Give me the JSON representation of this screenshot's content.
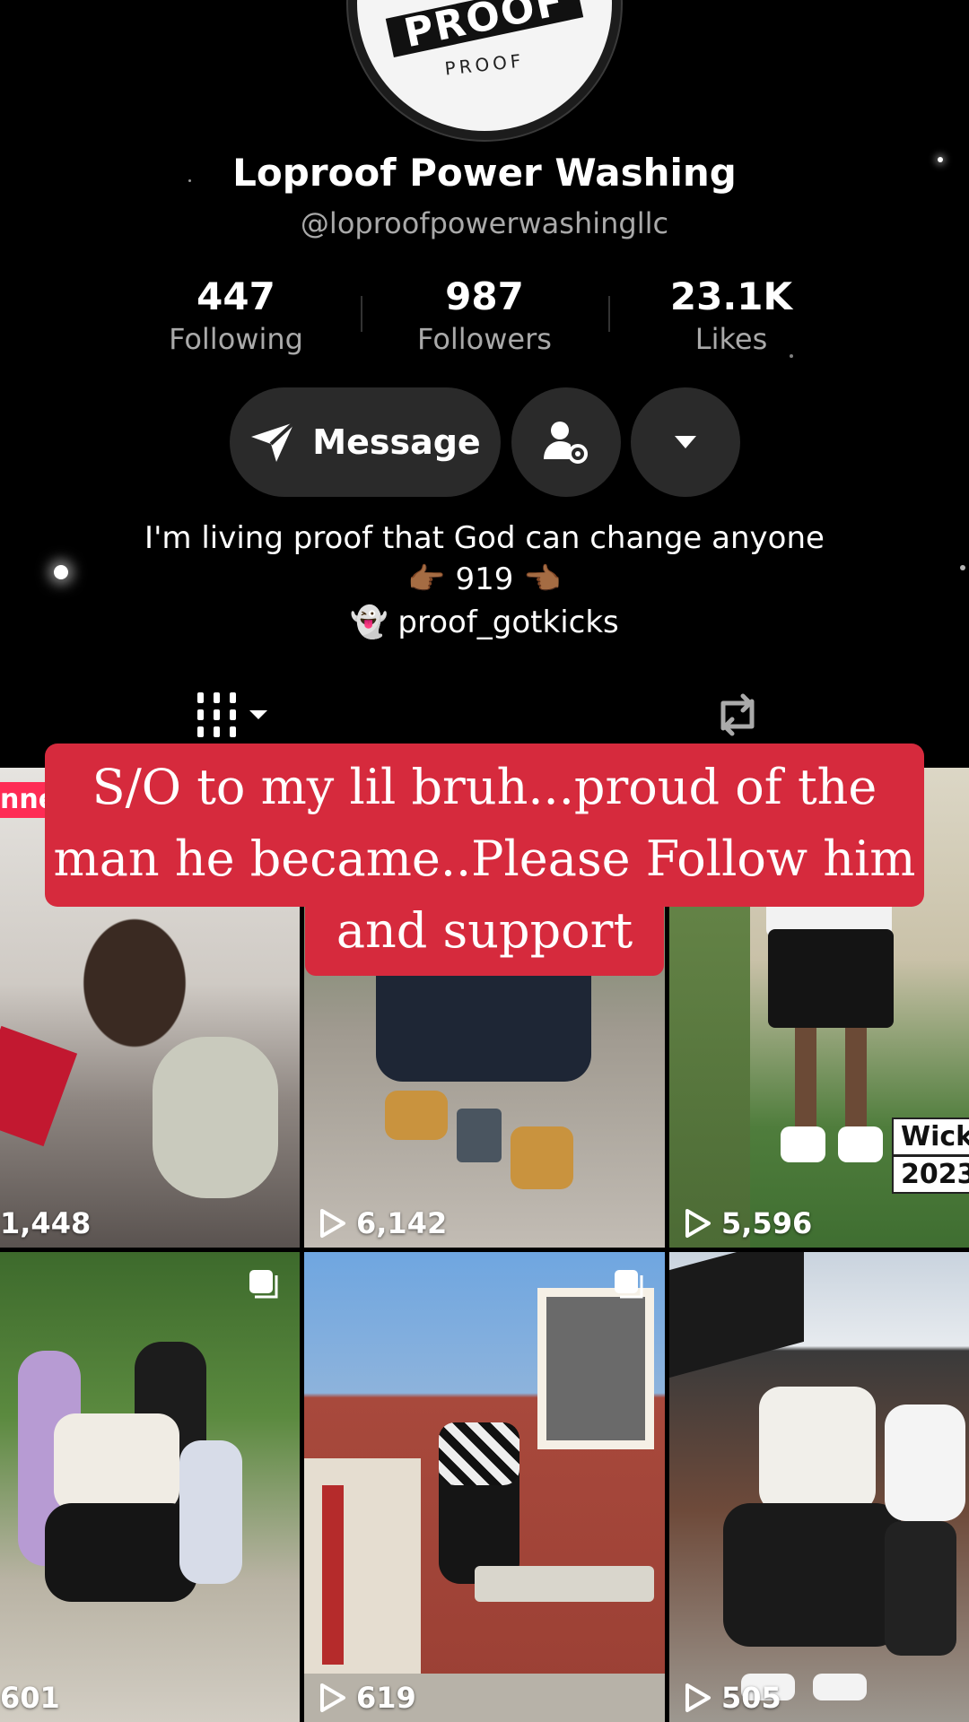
{
  "profile": {
    "logo_text": "PROOF",
    "logo_ring_text": "PROOF",
    "display_name": "Loproof Power Washing",
    "username": "@loproofpowerwashingllc"
  },
  "stats": {
    "following": {
      "value": "447",
      "label": "Following"
    },
    "followers": {
      "value": "987",
      "label": "Followers"
    },
    "likes": {
      "value": "23.1K",
      "label": "Likes"
    }
  },
  "actions": {
    "message_label": "Message",
    "icons": [
      "send-icon",
      "user-settings-icon",
      "dropdown-arrow-icon"
    ]
  },
  "bio": {
    "line1": "I'm living proof that God can change anyone",
    "line2_emoji_left": "👉🏾",
    "line2_number": "919",
    "line2_emoji_right": "👈🏾",
    "line3_emoji": "👻",
    "line3_text": "proof_gotkicks"
  },
  "tabs": {
    "icons": [
      "videos-grid-icon",
      "reposts-icon"
    ]
  },
  "overlay_caption": {
    "line1": "S/O to my lil bruh...proud of the",
    "line2": "man he became..Please Follow him",
    "line3": "and support"
  },
  "grid": {
    "pinned_fragment": "nne",
    "tiles": [
      {
        "views": "1,448",
        "show_play": false
      },
      {
        "views": "6,142",
        "show_play": true
      },
      {
        "views": "5,596",
        "show_play": true,
        "label_line1": "Wicks",
        "label_line2": "2023"
      },
      {
        "views": "601",
        "show_play": false,
        "multi": true
      },
      {
        "views": "619",
        "show_play": true,
        "multi": true
      },
      {
        "views": "505",
        "show_play": true
      }
    ]
  },
  "colors": {
    "background": "#000000",
    "button_bg": "#2a2a2a",
    "secondary_text": "#a9a9a9",
    "caption_red": "#d62a3d",
    "pinned_pink": "#fe2c55"
  }
}
